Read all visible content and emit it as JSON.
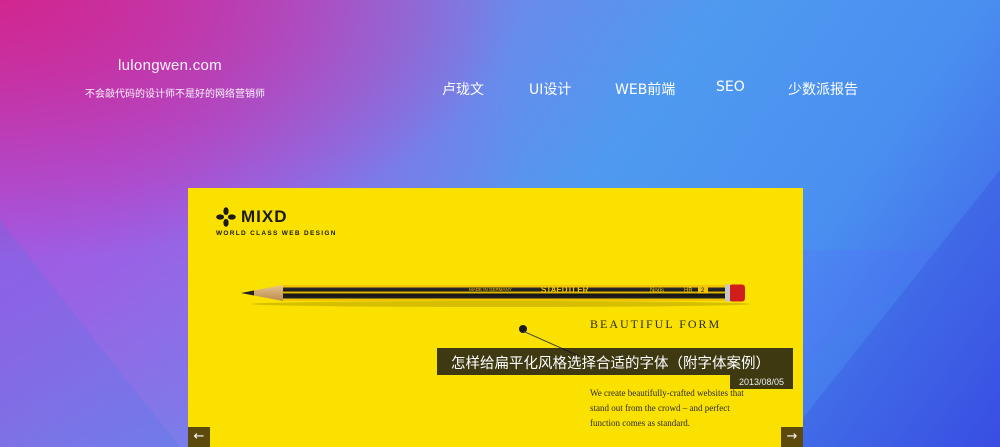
{
  "brand": {
    "site": "lulongwen.com",
    "tagline": "不会敲代码的设计师不是好的网络营销师"
  },
  "nav": [
    {
      "label": "卢珑文"
    },
    {
      "label": "UI设计"
    },
    {
      "label": "WEB前端"
    },
    {
      "label": "SEO"
    },
    {
      "label": "少数派报告"
    }
  ],
  "slide": {
    "logo_name": "MIXD",
    "logo_tagline": "WORLD CLASS WEB DESIGN",
    "pencil": {
      "made_in": "MADE IN GERMANY",
      "brand": "STAEDTLER",
      "model": "Noris",
      "grade": "HB",
      "number": "2"
    },
    "feature_title": "BEAUTIFUL FORM",
    "feature_lines": [
      "We create beautifully-crafted websites that",
      "stand out from the crowd – and perfect",
      "function comes as standard."
    ],
    "caption_title": "怎样给扁平化风格选择合适的字体（附字体案例）",
    "caption_date": "2013/08/05",
    "prev_arrow": "←",
    "next_arrow": "→"
  },
  "colors": {
    "slide_bg": "#fbe100",
    "caption_bg": "#141414",
    "arrow_bg": "#5b4a0b"
  }
}
